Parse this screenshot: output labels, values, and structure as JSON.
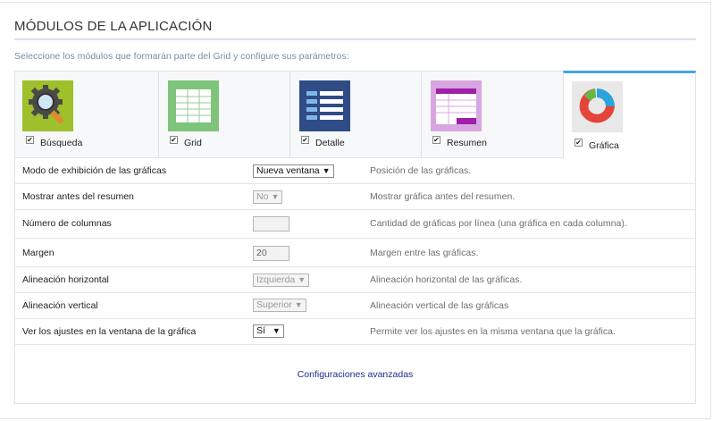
{
  "header": {
    "title": "MÓDULOS DE LA APLICACIÓN",
    "subtitle": "Seleccione los módulos que formarán parte del Grid y configure sus parámetros:"
  },
  "modules": [
    {
      "label": "Búsqueda",
      "checked": true,
      "icon": "search-settings-icon"
    },
    {
      "label": "Grid",
      "checked": true,
      "icon": "grid-icon"
    },
    {
      "label": "Detalle",
      "checked": true,
      "icon": "detail-list-icon"
    },
    {
      "label": "Resumen",
      "checked": true,
      "icon": "summary-icon"
    },
    {
      "label": "Gráfica",
      "checked": true,
      "icon": "chart-icon",
      "active": true
    }
  ],
  "settings": [
    {
      "label": "Modo de exhibición de las gráficas",
      "value": "Nueva ventana",
      "desc": "Posición de las gráficas."
    },
    {
      "label": "Mostrar antes del resumen",
      "value": "No",
      "desc": "Mostrar gráfica antes del resumen."
    },
    {
      "label": "Número de columnas",
      "value": "",
      "desc": "Cantidad de gráficas por línea (una gráfica en cada columna)."
    },
    {
      "label": "Margen",
      "value": "20",
      "desc": "Margen entre las gráficas."
    },
    {
      "label": "Alineación horizontal",
      "value": "Izquierda",
      "desc": "Alineación horizontal de las gráficas."
    },
    {
      "label": "Alineación vertical",
      "value": "Superior",
      "desc": "Alineación vertical de las gráficas"
    },
    {
      "label": "Ver los ajustes en la ventana de la gráfica",
      "value": "Sí",
      "desc": "Permite ver los ajustes en la misma ventana que la gráfica."
    }
  ],
  "advanced_link": "Configuraciones avanzadas",
  "colors": {
    "accent": "#47a4df",
    "link": "#1b2f86"
  }
}
